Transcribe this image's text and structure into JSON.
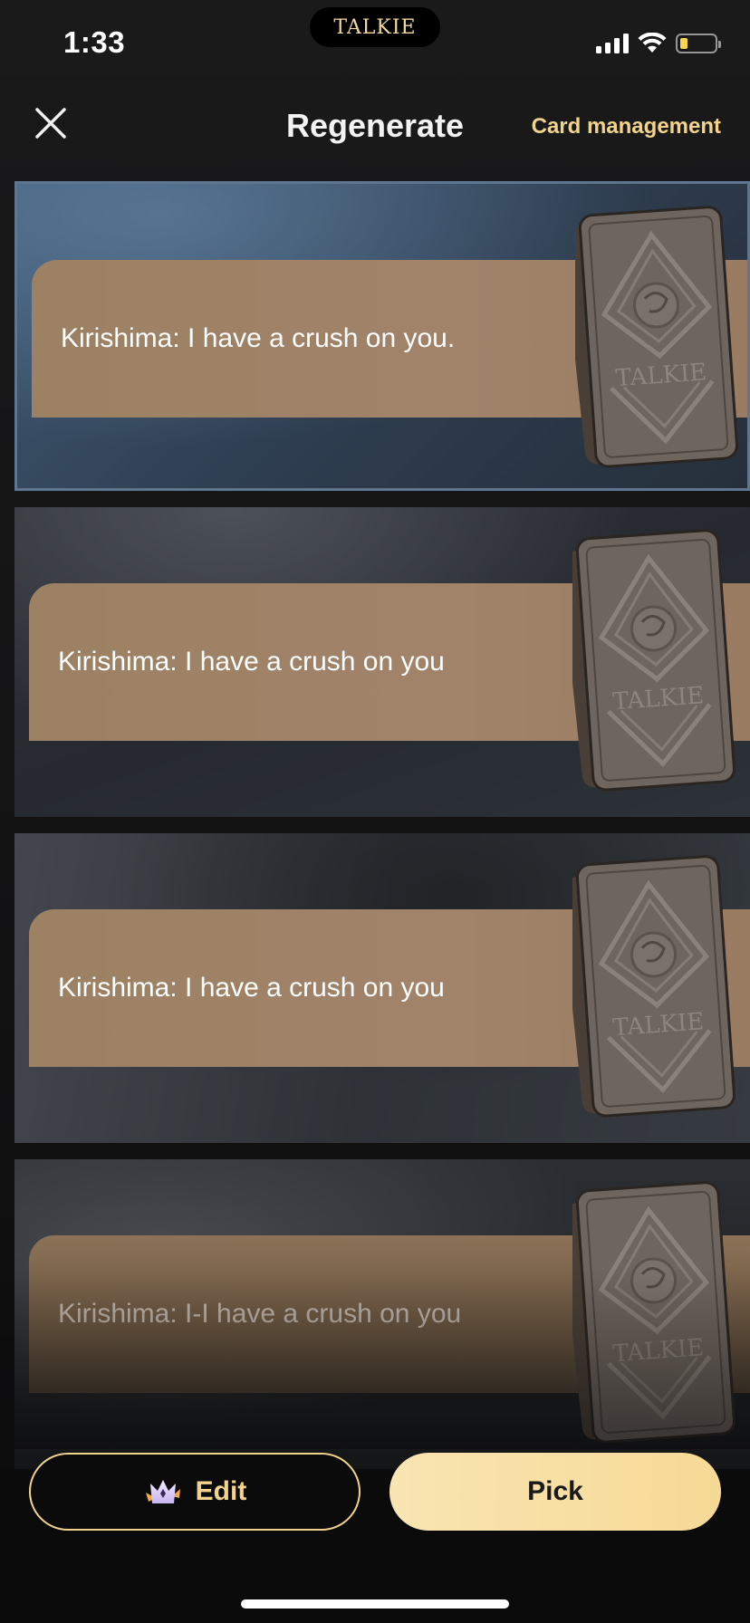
{
  "status_bar": {
    "time": "1:33",
    "island_logo": "TALKIE",
    "battery_level": 0.2
  },
  "header": {
    "title": "Regenerate",
    "card_management_label": "Card management"
  },
  "replies": [
    {
      "text": "Kirishima: I have a crush on you.",
      "selected": true,
      "card_logo": "TALKIE"
    },
    {
      "text": "Kirishima: I have a crush on you",
      "selected": false,
      "card_logo": "TALKIE"
    },
    {
      "text": "Kirishima: I have a crush on you",
      "selected": false,
      "card_logo": "TALKIE"
    },
    {
      "text": "Kirishima: I-I have a crush on you",
      "selected": false,
      "card_logo": "TALKIE"
    }
  ],
  "footer": {
    "edit_label": "Edit",
    "pick_label": "Pick"
  },
  "colors": {
    "accent_gold": "#f2d38c",
    "bubble_brown": "#9c8163",
    "selected_border": "#5e7690"
  }
}
